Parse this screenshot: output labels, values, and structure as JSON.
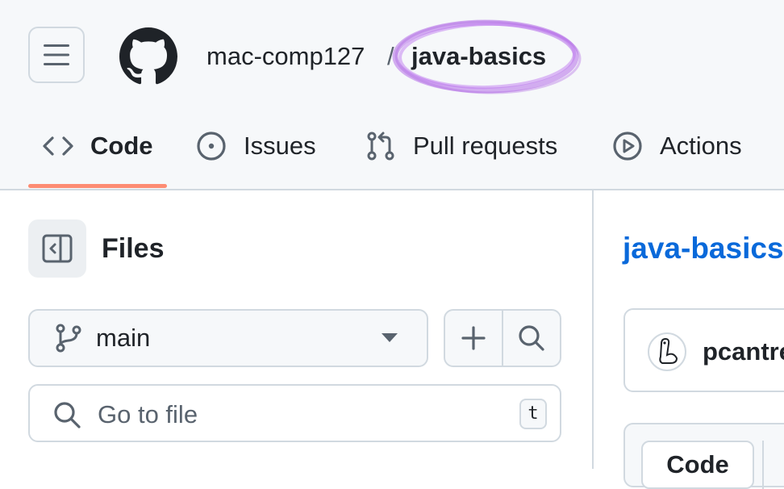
{
  "header": {
    "owner": "mac-comp127",
    "separator": "/",
    "repo": "java-basics",
    "highlight_color": "#b56ee8"
  },
  "tabs": [
    {
      "label": "Code",
      "icon": "code-icon",
      "selected": true
    },
    {
      "label": "Issues",
      "icon": "issue-opened-icon",
      "selected": false
    },
    {
      "label": "Pull requests",
      "icon": "git-pull-request-icon",
      "selected": false
    },
    {
      "label": "Actions",
      "icon": "play-icon",
      "selected": false
    }
  ],
  "colors": {
    "accent_underline": "#fd8c73",
    "link": "#0969da",
    "header_bg": "#f6f8fa",
    "border": "#d1d9e0"
  },
  "sidebar": {
    "title": "Files",
    "branch": "main",
    "search_placeholder": "Go to file",
    "shortcut": "t"
  },
  "main": {
    "repo_link": "java-basics",
    "commit_author": "pcantre",
    "view_tab": "Code"
  }
}
